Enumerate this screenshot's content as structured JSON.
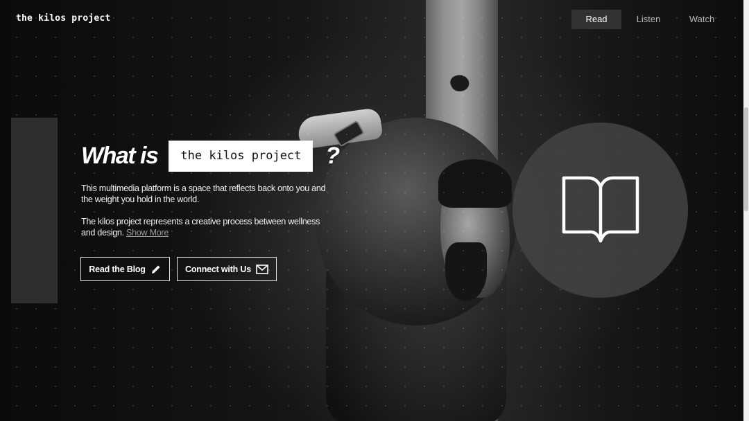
{
  "header": {
    "logo": "the kilos project",
    "nav": [
      {
        "label": "Read",
        "active": true
      },
      {
        "label": "Listen",
        "active": false
      },
      {
        "label": "Watch",
        "active": false
      }
    ]
  },
  "hero": {
    "headline_prefix": "What is",
    "headline_highlight": "the kilos project",
    "headline_suffix": "?",
    "paragraph1": "This multimedia platform is a space that reflects back onto you and the weight you hold in the world.",
    "paragraph2": "The kilos project represents a creative process between wellness and design.",
    "show_more": "Show More",
    "buttons": {
      "blog": {
        "label": "Read the Blog",
        "icon": "pencil-icon"
      },
      "connect": {
        "label": "Connect with Us",
        "icon": "envelope-icon"
      }
    },
    "feature_icon": "open-book-icon"
  },
  "colors": {
    "background": "#0a0a0a",
    "nav_active": "#333333",
    "accent_bar": "#2e2e2e",
    "highlight_box": "#ffffff",
    "circle": "#464646"
  }
}
